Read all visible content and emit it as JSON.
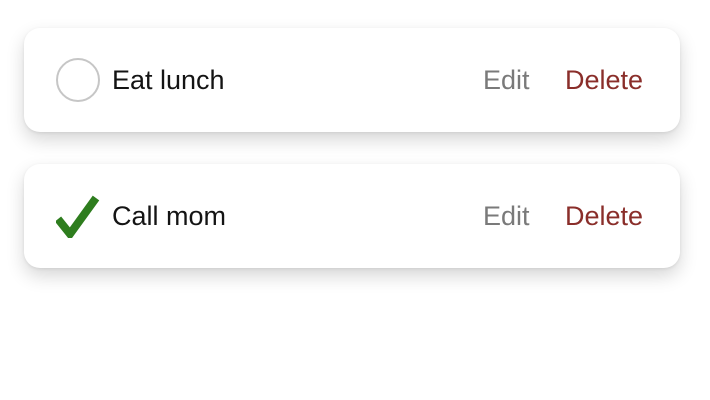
{
  "todos": [
    {
      "label": "Eat lunch",
      "completed": false,
      "edit_label": "Edit",
      "delete_label": "Delete"
    },
    {
      "label": "Call mom",
      "completed": true,
      "edit_label": "Edit",
      "delete_label": "Delete"
    }
  ],
  "colors": {
    "check": "#2e7d1e",
    "circle_border": "#c6c6c6",
    "edit": "#7a7a7a",
    "delete": "#8a2e2a",
    "text": "#141414"
  },
  "icons": {
    "incomplete": "circle-icon",
    "complete": "checkmark-icon"
  }
}
